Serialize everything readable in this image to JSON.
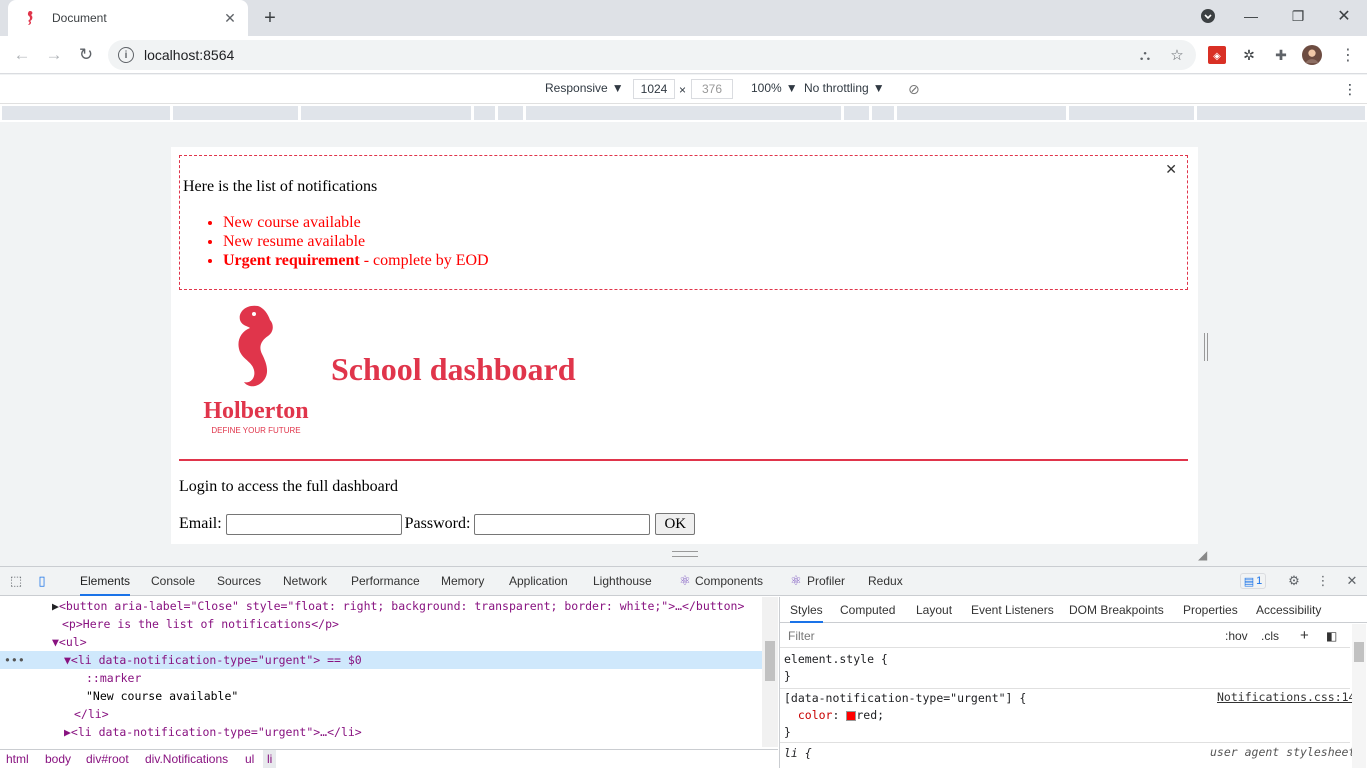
{
  "browser": {
    "tab_title": "Document",
    "url": "localhost:8564"
  },
  "device_toolbar": {
    "mode": "Responsive",
    "width": "1024",
    "height": "376",
    "times": "×",
    "zoom": "100%",
    "throttling": "No throttling"
  },
  "page": {
    "notifications_intro": "Here is the list of notifications",
    "notifications": [
      {
        "text": "New course available",
        "type": "default"
      },
      {
        "text": "New resume available",
        "type": "default"
      },
      {
        "bold": "Urgent requirement",
        "rest": " - complete by EOD",
        "type": "urgent"
      }
    ],
    "logo_name": "Holberton",
    "logo_tagline": "DEFINE YOUR FUTURE",
    "title": "School dashboard",
    "login_text": "Login to access the full dashboard",
    "email_label": "Email:",
    "password_label": "Password:",
    "ok_label": "OK",
    "accent_color": "#e0354b"
  },
  "devtools": {
    "tabs": [
      "Elements",
      "Console",
      "Sources",
      "Network",
      "Performance",
      "Memory",
      "Application",
      "Lighthouse",
      "Components",
      "Profiler",
      "Redux"
    ],
    "issues_count": "1",
    "elements_lines": [
      {
        "indent": "▶",
        "code": "<button aria-label=\"Close\" style=\"float: right; background: transparent; border: white;\">…</button>"
      },
      {
        "code": "<p>Here is the list of notifications</p>"
      },
      {
        "code": "▼<ul>"
      },
      {
        "code": "▼<li data-notification-type=\"urgent\"> == $0"
      },
      {
        "code": "::marker"
      },
      {
        "code": "\"New course available\""
      },
      {
        "code": "</li>"
      },
      {
        "code": "▶<li data-notification-type=\"urgent\">…</li>"
      }
    ],
    "breadcrumbs": [
      "html",
      "body",
      "div#root",
      "div.Notifications",
      "ul",
      "li"
    ],
    "style_tabs": [
      "Styles",
      "Computed",
      "Layout",
      "Event Listeners",
      "DOM Breakpoints",
      "Properties",
      "Accessibility"
    ],
    "filter_placeholder": "Filter",
    "hov": ":hov",
    "cls": ".cls",
    "element_style": "element.style {",
    "rule_selector": "[data-notification-type=\"urgent\"] {",
    "rule_source": "Notifications.css:14",
    "rule_prop": "color",
    "rule_value": "red;",
    "ua_selector": "li {",
    "ua_label": "user agent stylesheet"
  }
}
